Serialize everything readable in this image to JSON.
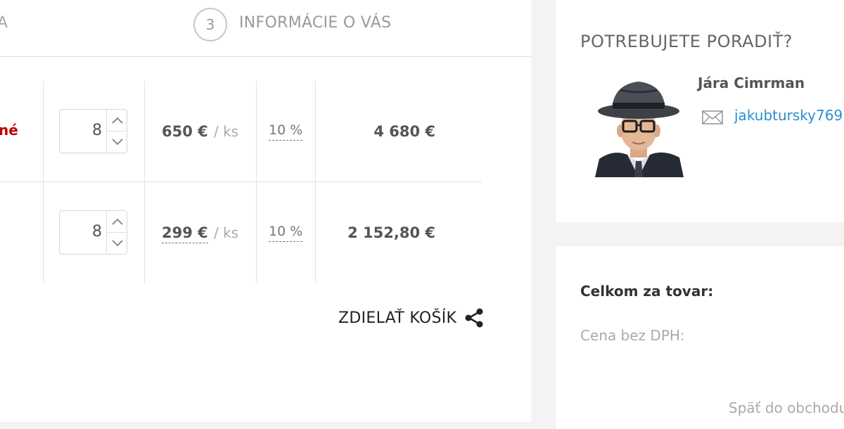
{
  "steps": {
    "previous_step_fragment": "A",
    "current_step_number": "3",
    "current_step_label": "INFORMÁCIE O VÁS"
  },
  "cart": {
    "items": [
      {
        "name_fragment": "né",
        "quantity": "8",
        "unit_price": "650 €",
        "unit": "/ ks",
        "discount": "10 %",
        "total": "4 680 €"
      },
      {
        "name_fragment": "",
        "quantity": "8",
        "unit_price": "299 €",
        "unit": "/ ks",
        "discount": "10 %",
        "total": "2 152,80 €"
      }
    ],
    "share_label": "ZDIELAŤ KOŠÍK"
  },
  "advice": {
    "title": "POTREBUJETE PORADIŤ?",
    "contact_name": "Jára Cimrman",
    "contact_email": "jakubtursky769"
  },
  "summary": {
    "title": "Celkom za tovar:",
    "net_price_label": "Cena bez DPH:",
    "back_link": "Späť do obchodu"
  },
  "colors": {
    "accent_red": "#c00000",
    "link_blue": "#2a8fd0",
    "background": "#f3f3f3"
  },
  "icons": [
    "chevron-up-icon",
    "chevron-down-icon",
    "share-icon",
    "envelope-icon"
  ]
}
